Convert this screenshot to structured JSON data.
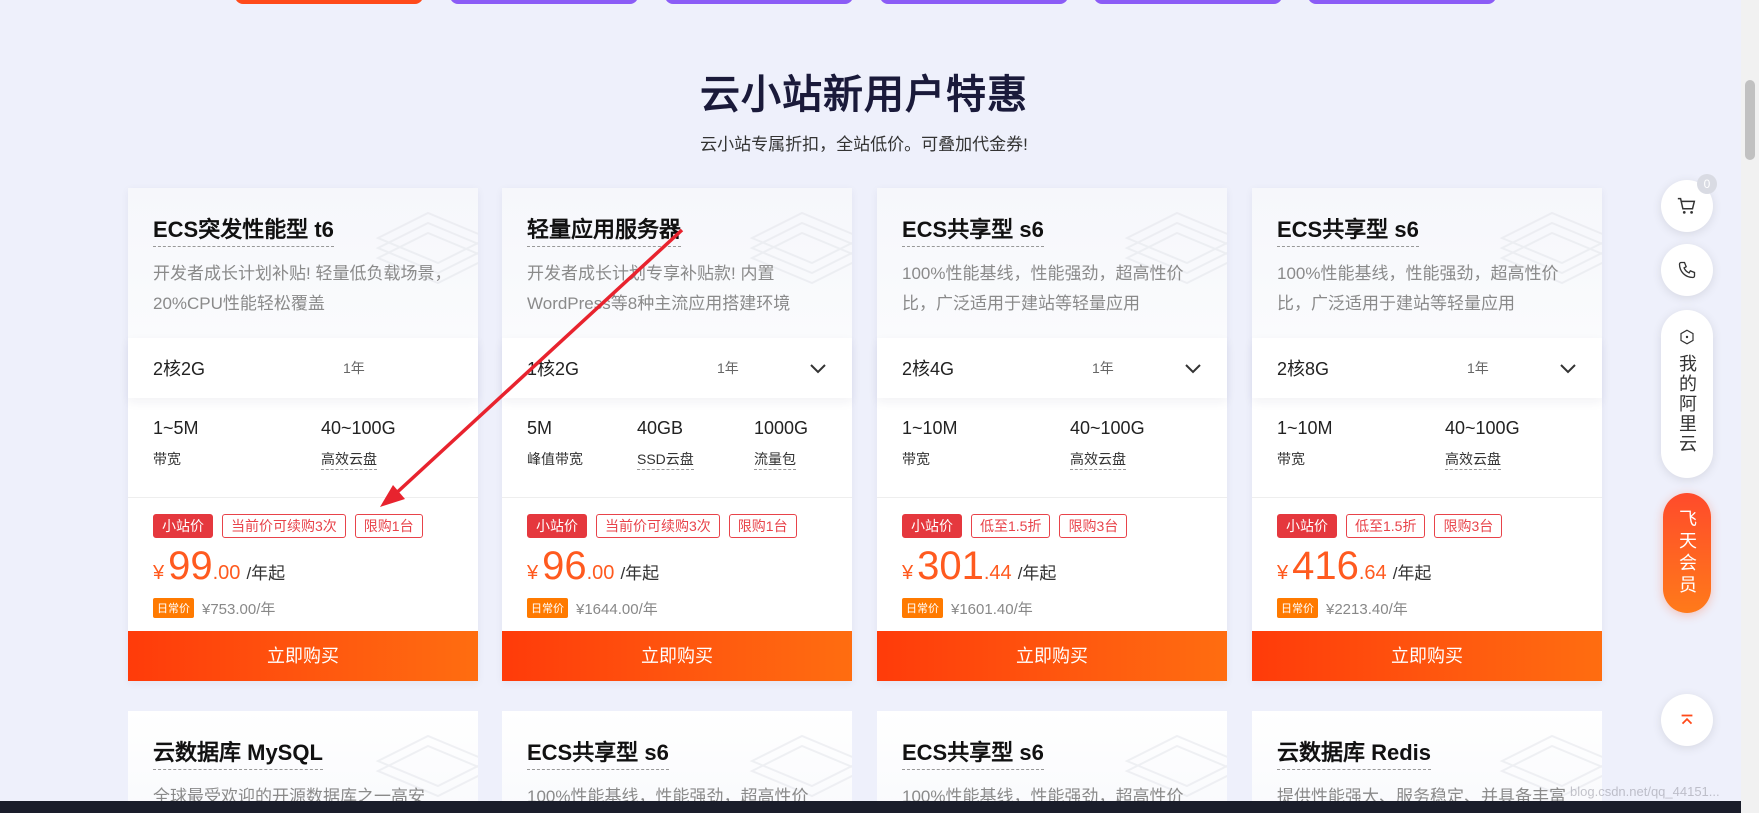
{
  "top_buttons": [
    {
      "color": "#ff4a1a"
    },
    {
      "color": "#8b5cf6"
    },
    {
      "color": "#8b5cf6"
    },
    {
      "color": "#8b5cf6"
    },
    {
      "color": "#8b5cf6"
    },
    {
      "color": "#8b5cf6"
    }
  ],
  "header": {
    "title": "云小站新用户特惠",
    "subtitle": "云小站专属折扣，全站低价。可叠加代金券!"
  },
  "cards": [
    {
      "name": "ECS突发性能型 t6",
      "desc": "开发者成长计划补贴! 轻量低负载场景，20%CPU性能轻松覆盖",
      "config": "2核2G",
      "period": "1年",
      "params": [
        {
          "value": "1~5M",
          "label": "带宽"
        },
        {
          "value": "40~100G",
          "label": "高效云盘"
        }
      ],
      "tags": [
        "小站价",
        "当前价可续购3次",
        "限购1台"
      ],
      "price_currency": "¥",
      "price_int": "99",
      "price_dec": ".00",
      "price_unit": "/年起",
      "orig_badge": "日常价",
      "orig_price": "¥753.00/年",
      "buy_label": "立即购买"
    },
    {
      "name": "轻量应用服务器",
      "desc": "开发者成长计划专享补贴款! 内置WordPress等8种主流应用搭建环境",
      "config": "1核2G",
      "period": "1年",
      "params": [
        {
          "value": "5M",
          "label": "峰值带宽"
        },
        {
          "value": "40GB",
          "label": "SSD云盘"
        },
        {
          "value": "1000G",
          "label": "流量包"
        }
      ],
      "tags": [
        "小站价",
        "当前价可续购3次",
        "限购1台"
      ],
      "price_currency": "¥",
      "price_int": "96",
      "price_dec": ".00",
      "price_unit": "/年起",
      "orig_badge": "日常价",
      "orig_price": "¥1644.00/年",
      "buy_label": "立即购买"
    },
    {
      "name": "ECS共享型 s6",
      "desc": "100%性能基线，性能强劲，超高性价比，广泛适用于建站等轻量应用",
      "config": "2核4G",
      "period": "1年",
      "params": [
        {
          "value": "1~10M",
          "label": "带宽"
        },
        {
          "value": "40~100G",
          "label": "高效云盘"
        }
      ],
      "tags": [
        "小站价",
        "低至1.5折",
        "限购3台"
      ],
      "price_currency": "¥",
      "price_int": "301",
      "price_dec": ".44",
      "price_unit": "/年起",
      "orig_badge": "日常价",
      "orig_price": "¥1601.40/年",
      "buy_label": "立即购买"
    },
    {
      "name": "ECS共享型 s6",
      "desc": "100%性能基线，性能强劲，超高性价比，广泛适用于建站等轻量应用",
      "config": "2核8G",
      "period": "1年",
      "params": [
        {
          "value": "1~10M",
          "label": "带宽"
        },
        {
          "value": "40~100G",
          "label": "高效云盘"
        }
      ],
      "tags": [
        "小站价",
        "低至1.5折",
        "限购3台"
      ],
      "price_currency": "¥",
      "price_int": "416",
      "price_dec": ".64",
      "price_unit": "/年起",
      "orig_badge": "日常价",
      "orig_price": "¥2213.40/年",
      "buy_label": "立即购买"
    }
  ],
  "lower_cards": [
    {
      "name": "云数据库 MySQL",
      "desc": "全球最受欢迎的开源数据库之一高安"
    },
    {
      "name": "ECS共享型 s6",
      "desc": "100%性能基线，性能强劲，超高性价"
    },
    {
      "name": "ECS共享型 s6",
      "desc": "100%性能基线，性能强劲，超高性价"
    },
    {
      "name": "云数据库 Redis",
      "desc": "提供性能强大、服务稳定、并具备丰富"
    }
  ],
  "sidebar": {
    "cart_count": "0",
    "my_aliyun": "我的阿里云",
    "member": "飞天会员"
  },
  "watermark": "blog.csdn.net/qq_44151..."
}
